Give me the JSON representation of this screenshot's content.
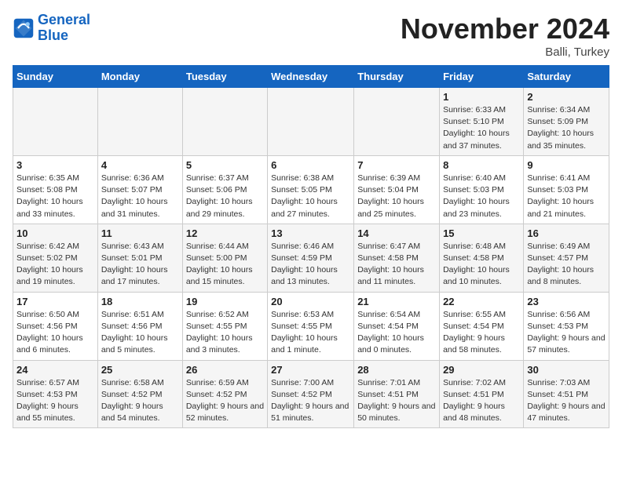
{
  "logo": {
    "line1": "General",
    "line2": "Blue"
  },
  "title": "November 2024",
  "location": "Balli, Turkey",
  "weekdays": [
    "Sunday",
    "Monday",
    "Tuesday",
    "Wednesday",
    "Thursday",
    "Friday",
    "Saturday"
  ],
  "weeks": [
    [
      {
        "day": "",
        "info": ""
      },
      {
        "day": "",
        "info": ""
      },
      {
        "day": "",
        "info": ""
      },
      {
        "day": "",
        "info": ""
      },
      {
        "day": "",
        "info": ""
      },
      {
        "day": "1",
        "info": "Sunrise: 6:33 AM\nSunset: 5:10 PM\nDaylight: 10 hours and 37 minutes."
      },
      {
        "day": "2",
        "info": "Sunrise: 6:34 AM\nSunset: 5:09 PM\nDaylight: 10 hours and 35 minutes."
      }
    ],
    [
      {
        "day": "3",
        "info": "Sunrise: 6:35 AM\nSunset: 5:08 PM\nDaylight: 10 hours and 33 minutes."
      },
      {
        "day": "4",
        "info": "Sunrise: 6:36 AM\nSunset: 5:07 PM\nDaylight: 10 hours and 31 minutes."
      },
      {
        "day": "5",
        "info": "Sunrise: 6:37 AM\nSunset: 5:06 PM\nDaylight: 10 hours and 29 minutes."
      },
      {
        "day": "6",
        "info": "Sunrise: 6:38 AM\nSunset: 5:05 PM\nDaylight: 10 hours and 27 minutes."
      },
      {
        "day": "7",
        "info": "Sunrise: 6:39 AM\nSunset: 5:04 PM\nDaylight: 10 hours and 25 minutes."
      },
      {
        "day": "8",
        "info": "Sunrise: 6:40 AM\nSunset: 5:03 PM\nDaylight: 10 hours and 23 minutes."
      },
      {
        "day": "9",
        "info": "Sunrise: 6:41 AM\nSunset: 5:03 PM\nDaylight: 10 hours and 21 minutes."
      }
    ],
    [
      {
        "day": "10",
        "info": "Sunrise: 6:42 AM\nSunset: 5:02 PM\nDaylight: 10 hours and 19 minutes."
      },
      {
        "day": "11",
        "info": "Sunrise: 6:43 AM\nSunset: 5:01 PM\nDaylight: 10 hours and 17 minutes."
      },
      {
        "day": "12",
        "info": "Sunrise: 6:44 AM\nSunset: 5:00 PM\nDaylight: 10 hours and 15 minutes."
      },
      {
        "day": "13",
        "info": "Sunrise: 6:46 AM\nSunset: 4:59 PM\nDaylight: 10 hours and 13 minutes."
      },
      {
        "day": "14",
        "info": "Sunrise: 6:47 AM\nSunset: 4:58 PM\nDaylight: 10 hours and 11 minutes."
      },
      {
        "day": "15",
        "info": "Sunrise: 6:48 AM\nSunset: 4:58 PM\nDaylight: 10 hours and 10 minutes."
      },
      {
        "day": "16",
        "info": "Sunrise: 6:49 AM\nSunset: 4:57 PM\nDaylight: 10 hours and 8 minutes."
      }
    ],
    [
      {
        "day": "17",
        "info": "Sunrise: 6:50 AM\nSunset: 4:56 PM\nDaylight: 10 hours and 6 minutes."
      },
      {
        "day": "18",
        "info": "Sunrise: 6:51 AM\nSunset: 4:56 PM\nDaylight: 10 hours and 5 minutes."
      },
      {
        "day": "19",
        "info": "Sunrise: 6:52 AM\nSunset: 4:55 PM\nDaylight: 10 hours and 3 minutes."
      },
      {
        "day": "20",
        "info": "Sunrise: 6:53 AM\nSunset: 4:55 PM\nDaylight: 10 hours and 1 minute."
      },
      {
        "day": "21",
        "info": "Sunrise: 6:54 AM\nSunset: 4:54 PM\nDaylight: 10 hours and 0 minutes."
      },
      {
        "day": "22",
        "info": "Sunrise: 6:55 AM\nSunset: 4:54 PM\nDaylight: 9 hours and 58 minutes."
      },
      {
        "day": "23",
        "info": "Sunrise: 6:56 AM\nSunset: 4:53 PM\nDaylight: 9 hours and 57 minutes."
      }
    ],
    [
      {
        "day": "24",
        "info": "Sunrise: 6:57 AM\nSunset: 4:53 PM\nDaylight: 9 hours and 55 minutes."
      },
      {
        "day": "25",
        "info": "Sunrise: 6:58 AM\nSunset: 4:52 PM\nDaylight: 9 hours and 54 minutes."
      },
      {
        "day": "26",
        "info": "Sunrise: 6:59 AM\nSunset: 4:52 PM\nDaylight: 9 hours and 52 minutes."
      },
      {
        "day": "27",
        "info": "Sunrise: 7:00 AM\nSunset: 4:52 PM\nDaylight: 9 hours and 51 minutes."
      },
      {
        "day": "28",
        "info": "Sunrise: 7:01 AM\nSunset: 4:51 PM\nDaylight: 9 hours and 50 minutes."
      },
      {
        "day": "29",
        "info": "Sunrise: 7:02 AM\nSunset: 4:51 PM\nDaylight: 9 hours and 48 minutes."
      },
      {
        "day": "30",
        "info": "Sunrise: 7:03 AM\nSunset: 4:51 PM\nDaylight: 9 hours and 47 minutes."
      }
    ]
  ]
}
